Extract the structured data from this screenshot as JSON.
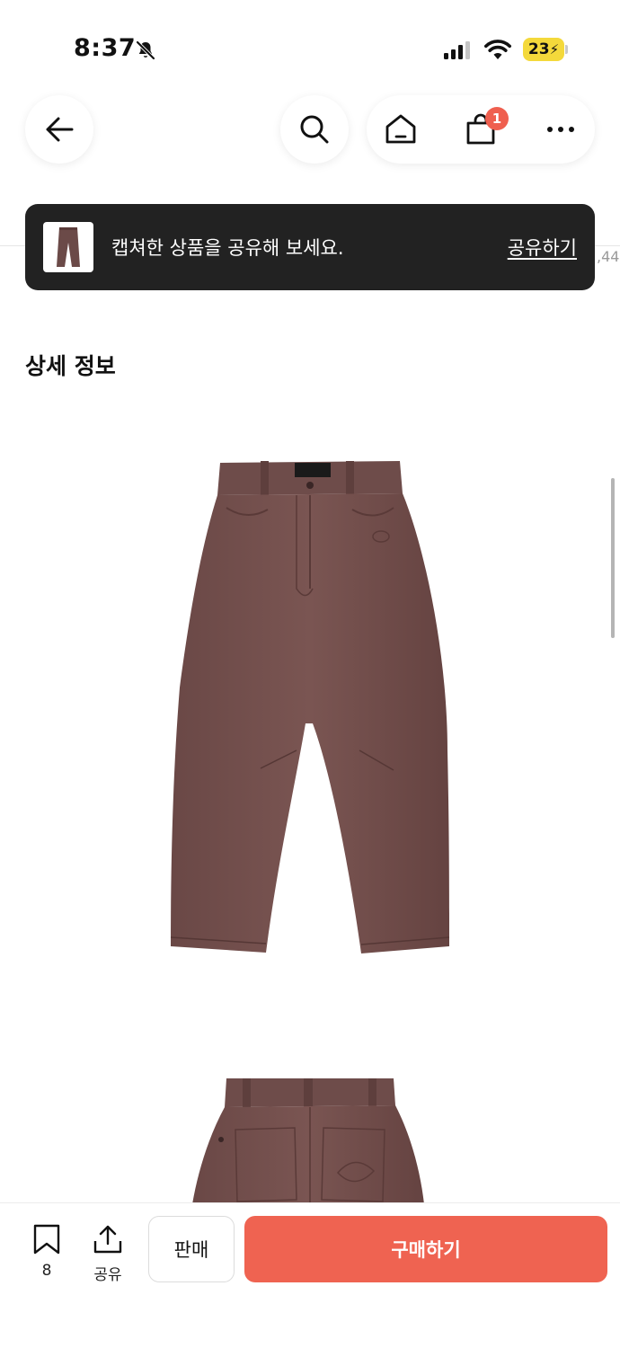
{
  "status_bar": {
    "time": "8:37",
    "battery_level": "23",
    "icons": [
      "bell-slash-icon",
      "signal-icon",
      "wifi-icon",
      "battery-charging-icon"
    ],
    "battery_color": "#f4d93b"
  },
  "header": {
    "icons": [
      "arrow-left-icon",
      "search-icon",
      "home-icon",
      "shopping-bag-icon",
      "more-icon"
    ],
    "cart_count": "1",
    "badge_color": "#ef5f4f"
  },
  "underlying": {
    "price_fragment": ",44"
  },
  "toast": {
    "message": "캡쳐한 상품을 공유해 보세요.",
    "action_label": "공유하기"
  },
  "detail": {
    "section_title": "상세 정보"
  },
  "bottom_bar": {
    "bookmark_count": "8",
    "share_label": "공유",
    "sell_label": "판매",
    "buy_label": "구매하기",
    "buy_color": "#ef6351"
  }
}
